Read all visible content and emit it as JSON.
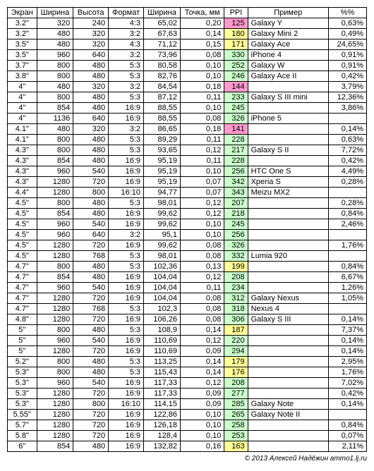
{
  "headers": [
    "Экран",
    "Ширина",
    "Высота",
    "Формат",
    "Ширина",
    "Точка, мм",
    "PPI",
    "Пример",
    "%%"
  ],
  "footer": "© 2013 Алексей Надёжин ammo1.lj.ru",
  "rows": [
    {
      "screen": "3.2\"",
      "w": "320",
      "h": "240",
      "fmt": "4:3",
      "wmm": "65,02",
      "dot": "0,20",
      "ppi": "125",
      "ppiColor": "#ff99cc",
      "ex": "Galaxy Y",
      "pct": "0,63%"
    },
    {
      "screen": "3.2\"",
      "w": "480",
      "h": "320",
      "fmt": "3:2",
      "wmm": "67,63",
      "dot": "0,14",
      "ppi": "180",
      "ppiColor": "#ffff99",
      "ex": "Galaxy Mini 2",
      "pct": "0,49%"
    },
    {
      "screen": "3.5\"",
      "w": "480",
      "h": "320",
      "fmt": "4:3",
      "wmm": "71,12",
      "dot": "0,15",
      "ppi": "171",
      "ppiColor": "#ffff99",
      "ex": "Galaxy Ace",
      "pct": "24,65%"
    },
    {
      "screen": "3.5\"",
      "w": "960",
      "h": "640",
      "fmt": "3:2",
      "wmm": "73,96",
      "dot": "0,08",
      "ppi": "330",
      "ppiColor": "#ccffcc",
      "ex": "iPhone 4",
      "pct": "0,91%"
    },
    {
      "screen": "3.7\"",
      "w": "800",
      "h": "480",
      "fmt": "5:3",
      "wmm": "80,58",
      "dot": "0,10",
      "ppi": "252",
      "ppiColor": "#ccffcc",
      "ex": "Galaxy W",
      "pct": "0,91%"
    },
    {
      "screen": "3.8\"",
      "w": "800",
      "h": "480",
      "fmt": "5:3",
      "wmm": "82,76",
      "dot": "0,10",
      "ppi": "246",
      "ppiColor": "#ccffcc",
      "ex": "Galaxy Ace II",
      "pct": "0,42%"
    },
    {
      "screen": "4\"",
      "w": "480",
      "h": "320",
      "fmt": "3:2",
      "wmm": "84,54",
      "dot": "0,18",
      "ppi": "144",
      "ppiColor": "#ff99cc",
      "ex": "",
      "pct": "3,79%"
    },
    {
      "screen": "4\"",
      "w": "800",
      "h": "480",
      "fmt": "5:3",
      "wmm": "87,12",
      "dot": "0,11",
      "ppi": "233",
      "ppiColor": "#ccffcc",
      "ex": "Galaxy S III mini",
      "pct": "12,36%"
    },
    {
      "screen": "4\"",
      "w": "854",
      "h": "480",
      "fmt": "16:9",
      "wmm": "88,55",
      "dot": "0,10",
      "ppi": "245",
      "ppiColor": "#ccffcc",
      "ex": "",
      "pct": "3,86%"
    },
    {
      "screen": "4\"",
      "w": "1136",
      "h": "640",
      "fmt": "16:9",
      "wmm": "88,55",
      "dot": "0,08",
      "ppi": "326",
      "ppiColor": "#ccffcc",
      "ex": "iPhone 5",
      "pct": ""
    },
    {
      "screen": "4.1\"",
      "w": "480",
      "h": "320",
      "fmt": "3:2",
      "wmm": "86,65",
      "dot": "0,18",
      "ppi": "141",
      "ppiColor": "#ff99cc",
      "ex": "",
      "pct": "0,14%"
    },
    {
      "screen": "4.1\"",
      "w": "800",
      "h": "480",
      "fmt": "5:3",
      "wmm": "89,29",
      "dot": "0,11",
      "ppi": "228",
      "ppiColor": "#ccffcc",
      "ex": "",
      "pct": "0,63%"
    },
    {
      "screen": "4.3\"",
      "w": "800",
      "h": "480",
      "fmt": "5:3",
      "wmm": "93,65",
      "dot": "0,12",
      "ppi": "217",
      "ppiColor": "#ccffcc",
      "ex": "Galaxy S II",
      "pct": "7,72%"
    },
    {
      "screen": "4.3\"",
      "w": "854",
      "h": "480",
      "fmt": "16:9",
      "wmm": "95,19",
      "dot": "0,11",
      "ppi": "228",
      "ppiColor": "#ccffcc",
      "ex": "",
      "pct": "0,42%"
    },
    {
      "screen": "4.3\"",
      "w": "960",
      "h": "540",
      "fmt": "16:9",
      "wmm": "95,19",
      "dot": "0,10",
      "ppi": "256",
      "ppiColor": "#ccffcc",
      "ex": "HTC One S",
      "pct": "4,49%"
    },
    {
      "screen": "4.3\"",
      "w": "1280",
      "h": "720",
      "fmt": "16:9",
      "wmm": "95,19",
      "dot": "0,07",
      "ppi": "342",
      "ppiColor": "#ccffcc",
      "ex": "Xperia S",
      "pct": "0,28%"
    },
    {
      "screen": "4.4\"",
      "w": "1280",
      "h": "800",
      "fmt": "16:10",
      "wmm": "94,77",
      "dot": "0,07",
      "ppi": "343",
      "ppiColor": "#ccffcc",
      "ex": "Meizu MX2",
      "pct": ""
    },
    {
      "screen": "4.5\"",
      "w": "800",
      "h": "480",
      "fmt": "5:3",
      "wmm": "98,01",
      "dot": "0,12",
      "ppi": "207",
      "ppiColor": "#ccffcc",
      "ex": "",
      "pct": "0,28%"
    },
    {
      "screen": "4.5\"",
      "w": "854",
      "h": "480",
      "fmt": "16:9",
      "wmm": "99,62",
      "dot": "0,12",
      "ppi": "218",
      "ppiColor": "#ccffcc",
      "ex": "",
      "pct": "0,84%"
    },
    {
      "screen": "4.5\"",
      "w": "960",
      "h": "540",
      "fmt": "16:9",
      "wmm": "99,62",
      "dot": "0,10",
      "ppi": "245",
      "ppiColor": "#ccffcc",
      "ex": "",
      "pct": "2,46%"
    },
    {
      "screen": "4.5\"",
      "w": "960",
      "h": "640",
      "fmt": "3:2",
      "wmm": "95,1",
      "dot": "0,10",
      "ppi": "256",
      "ppiColor": "#ccffcc",
      "ex": "",
      "pct": ""
    },
    {
      "screen": "4.5\"",
      "w": "1280",
      "h": "720",
      "fmt": "16:9",
      "wmm": "99,62",
      "dot": "0,08",
      "ppi": "326",
      "ppiColor": "#ccffcc",
      "ex": "",
      "pct": "1,76%"
    },
    {
      "screen": "4.5\"",
      "w": "1280",
      "h": "768",
      "fmt": "5:3",
      "wmm": "98,01",
      "dot": "0,08",
      "ppi": "332",
      "ppiColor": "#ccffcc",
      "ex": "Lumia 920",
      "pct": ""
    },
    {
      "screen": "4.7\"",
      "w": "800",
      "h": "480",
      "fmt": "5:3",
      "wmm": "102,36",
      "dot": "0,13",
      "ppi": "199",
      "ppiColor": "#ffff99",
      "ex": "",
      "pct": "0,84%"
    },
    {
      "screen": "4.7\"",
      "w": "854",
      "h": "480",
      "fmt": "16:9",
      "wmm": "104,04",
      "dot": "0,12",
      "ppi": "208",
      "ppiColor": "#ccffcc",
      "ex": "",
      "pct": "6,67%"
    },
    {
      "screen": "4.7\"",
      "w": "960",
      "h": "540",
      "fmt": "16:9",
      "wmm": "104,04",
      "dot": "0,11",
      "ppi": "234",
      "ppiColor": "#ccffcc",
      "ex": "",
      "pct": "1,26%"
    },
    {
      "screen": "4.7\"",
      "w": "1280",
      "h": "720",
      "fmt": "16:9",
      "wmm": "104,04",
      "dot": "0,08",
      "ppi": "312",
      "ppiColor": "#ccffcc",
      "ex": "Galaxy Nexus",
      "pct": "1,05%"
    },
    {
      "screen": "4.7\"",
      "w": "1280",
      "h": "768",
      "fmt": "5:3",
      "wmm": "102,3",
      "dot": "0,08",
      "ppi": "318",
      "ppiColor": "#ccffcc",
      "ex": "Nexus 4",
      "pct": ""
    },
    {
      "screen": "4.8\"",
      "w": "1280",
      "h": "720",
      "fmt": "16:9",
      "wmm": "106,26",
      "dot": "0,08",
      "ppi": "306",
      "ppiColor": "#ccffcc",
      "ex": "Galaxy S III",
      "pct": "0,14%"
    },
    {
      "screen": "5\"",
      "w": "800",
      "h": "480",
      "fmt": "5:3",
      "wmm": "108,9",
      "dot": "0,14",
      "ppi": "187",
      "ppiColor": "#ffff99",
      "ex": "",
      "pct": "7,37%"
    },
    {
      "screen": "5\"",
      "w": "960",
      "h": "540",
      "fmt": "16:9",
      "wmm": "110,69",
      "dot": "0,12",
      "ppi": "220",
      "ppiColor": "#ccffcc",
      "ex": "",
      "pct": "0,14%"
    },
    {
      "screen": "5\"",
      "w": "1280",
      "h": "720",
      "fmt": "16:9",
      "wmm": "110,69",
      "dot": "0,09",
      "ppi": "294",
      "ppiColor": "#ccffcc",
      "ex": "",
      "pct": "0,14%"
    },
    {
      "screen": "5.2\"",
      "w": "800",
      "h": "480",
      "fmt": "5:3",
      "wmm": "113,25",
      "dot": "0,14",
      "ppi": "179",
      "ppiColor": "#ffff99",
      "ex": "",
      "pct": "2,95%"
    },
    {
      "screen": "5.3\"",
      "w": "800",
      "h": "480",
      "fmt": "5:3",
      "wmm": "115,43",
      "dot": "0,14",
      "ppi": "176",
      "ppiColor": "#ffff99",
      "ex": "",
      "pct": "1,76%"
    },
    {
      "screen": "5.3\"",
      "w": "960",
      "h": "540",
      "fmt": "16:9",
      "wmm": "117,33",
      "dot": "0,12",
      "ppi": "208",
      "ppiColor": "#ccffcc",
      "ex": "",
      "pct": "7,02%"
    },
    {
      "screen": "5.3\"",
      "w": "1280",
      "h": "720",
      "fmt": "16:9",
      "wmm": "117,33",
      "dot": "0,09",
      "ppi": "277",
      "ppiColor": "#ccffcc",
      "ex": "",
      "pct": "0,42%"
    },
    {
      "screen": "5.3\"",
      "w": "1280",
      "h": "800",
      "fmt": "16:10",
      "wmm": "114,15",
      "dot": "0,09",
      "ppi": "285",
      "ppiColor": "#ccffcc",
      "ex": "Galaxy Note",
      "pct": "0,14%"
    },
    {
      "screen": "5.55\"",
      "w": "1280",
      "h": "720",
      "fmt": "16:9",
      "wmm": "122,86",
      "dot": "0,10",
      "ppi": "265",
      "ppiColor": "#ccffcc",
      "ex": "Galaxy Note II",
      "pct": ""
    },
    {
      "screen": "5.7\"",
      "w": "1280",
      "h": "720",
      "fmt": "16:9",
      "wmm": "126,18",
      "dot": "0,10",
      "ppi": "258",
      "ppiColor": "#ccffcc",
      "ex": "",
      "pct": "0,84%"
    },
    {
      "screen": "5.8\"",
      "w": "1280",
      "h": "720",
      "fmt": "16:9",
      "wmm": "128,4",
      "dot": "0,10",
      "ppi": "253",
      "ppiColor": "#ccffcc",
      "ex": "",
      "pct": "0,07%"
    },
    {
      "screen": "6\"",
      "w": "854",
      "h": "480",
      "fmt": "16:9",
      "wmm": "132,82",
      "dot": "0,16",
      "ppi": "163",
      "ppiColor": "#ffff99",
      "ex": "",
      "pct": "2,11%"
    }
  ]
}
